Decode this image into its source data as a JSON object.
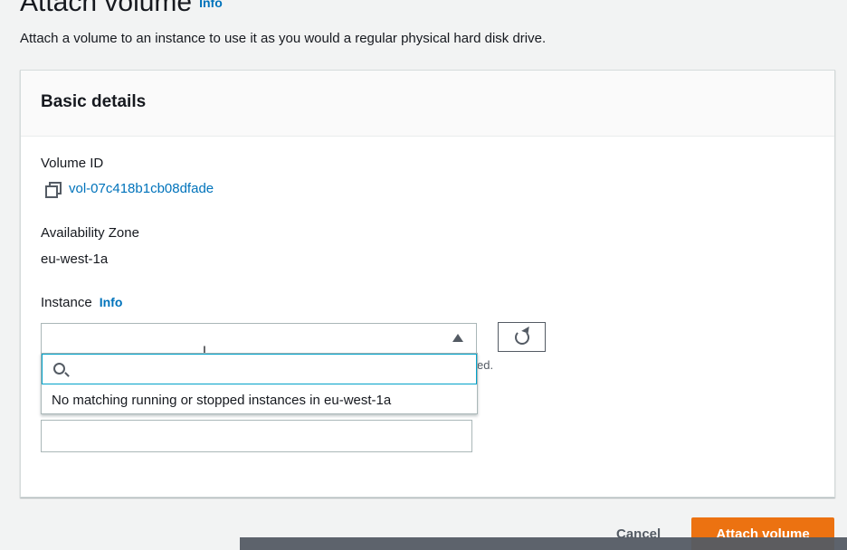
{
  "page": {
    "title": "Attach volume",
    "title_info": "Info",
    "description": "Attach a volume to an instance to use it as you would a regular physical hard disk drive."
  },
  "panel": {
    "header": "Basic details",
    "volume_id_label": "Volume ID",
    "volume_id": "vol-07c418b1cb08dfade",
    "az_label": "Availability Zone",
    "az_value": "eu-west-1a",
    "instance_label": "Instance",
    "instance_info": "Info",
    "instance_select_value": "",
    "hint_fragment": "ed.",
    "search_placeholder": "",
    "no_match": "No matching running or stopped instances in eu-west-1a",
    "device_name_value": ""
  },
  "footer": {
    "cancel": "Cancel",
    "attach": "Attach volume"
  },
  "colors": {
    "accent": "#ec7211",
    "link": "#0073bb",
    "focus": "#00a1c9"
  },
  "icons": [
    "copy-icon",
    "caret-up-icon",
    "refresh-icon",
    "search-icon",
    "text-cursor-icon"
  ]
}
